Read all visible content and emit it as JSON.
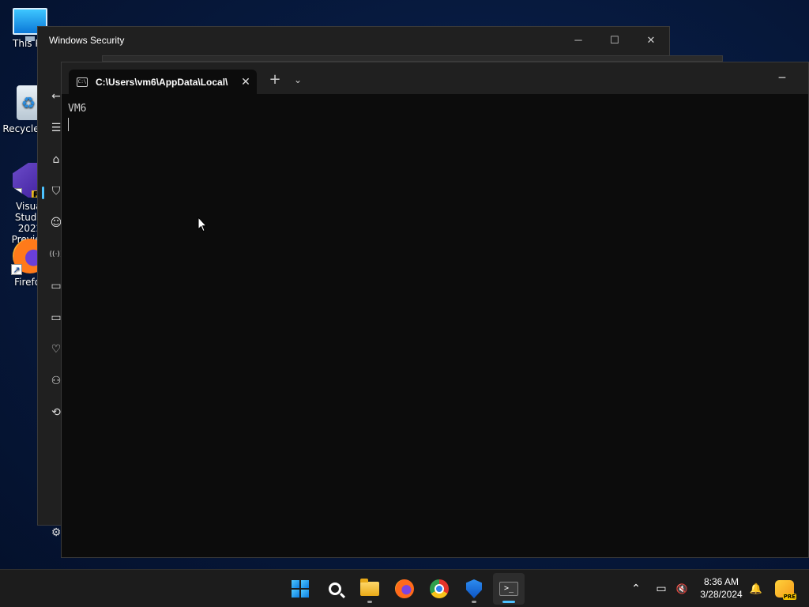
{
  "desktop": {
    "icons": [
      {
        "label": "This PC",
        "icon": "monitor-icon"
      },
      {
        "label": "Recycle Bin",
        "icon": "recycle-bin-icon"
      },
      {
        "label": "Visual Studio 2022 Preview",
        "line1": "Visual Studio",
        "line2": "2022 Preview",
        "badge": "PRE",
        "icon": "visual-studio-icon"
      },
      {
        "label": "Firefox",
        "icon": "firefox-icon"
      }
    ],
    "shortcut_arrow": "↗"
  },
  "security_window": {
    "title": "Windows Security",
    "controls": {
      "minimize": "─",
      "maximize": "☐",
      "close": "✕"
    },
    "nav_icons": {
      "back": "←",
      "menu": "☰",
      "home": "⌂",
      "shield": "⛉",
      "account": "☺",
      "firewall": "((·))",
      "app_browser": "▭",
      "device_security": "▭",
      "performance": "♡",
      "family": "⚇",
      "history": "⟲",
      "settings": "⚙"
    },
    "accent": "#4cc2ff"
  },
  "terminal": {
    "tab_title": "C:\\Users\\vm6\\AppData\\Local\\",
    "tab_icon_text": "C:\\",
    "tab_close": "✕",
    "new_tab": "+",
    "dropdown": "⌄",
    "minimize": "─",
    "output": [
      "VM6"
    ],
    "background": "#0c0c0c"
  },
  "taskbar": {
    "apps": [
      "start",
      "search",
      "file-explorer",
      "firefox",
      "chrome",
      "windows-security",
      "terminal"
    ],
    "active_app": "terminal",
    "tray": {
      "overflow": "⌃",
      "network": "▭",
      "volume": "🔇",
      "notifications": "🔔"
    },
    "clock": {
      "time": "8:36 AM",
      "date": "3/28/2024"
    },
    "copilot_badge": "PRE"
  }
}
